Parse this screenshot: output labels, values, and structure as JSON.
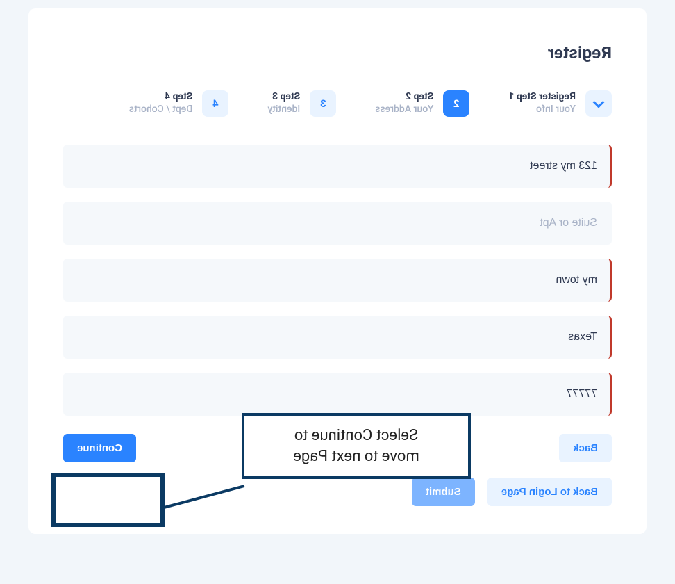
{
  "title": "Register",
  "steps": [
    {
      "badge": "check",
      "title": "Register Step 1",
      "sub": "Your Info",
      "state": "done"
    },
    {
      "badge": "2",
      "title": "Step 2",
      "sub": "Your Address",
      "state": "active"
    },
    {
      "badge": "3",
      "title": "Step 3",
      "sub": "Identity",
      "state": "pending"
    },
    {
      "badge": "4",
      "title": "Step 4",
      "sub": "Dept / Cohorts",
      "state": "pending"
    }
  ],
  "fields": {
    "street": {
      "value": "123 my street",
      "placeholder": "",
      "required": true
    },
    "suite": {
      "value": "",
      "placeholder": "Suite or Apt",
      "required": false
    },
    "city": {
      "value": "my town",
      "placeholder": "",
      "required": true
    },
    "state": {
      "value": "Texas",
      "placeholder": "",
      "required": true
    },
    "zip": {
      "value": "77777",
      "placeholder": "",
      "required": true
    }
  },
  "buttons": {
    "back": "Back",
    "continue": "Continue",
    "back_login": "Back to Login Page",
    "submit": "Submit"
  },
  "callout": {
    "line1": "Select Continue to",
    "line2": "move to next Page"
  },
  "colors": {
    "accent": "#2a83ff",
    "dark": "#0b3a63",
    "required": "#c0392b"
  }
}
